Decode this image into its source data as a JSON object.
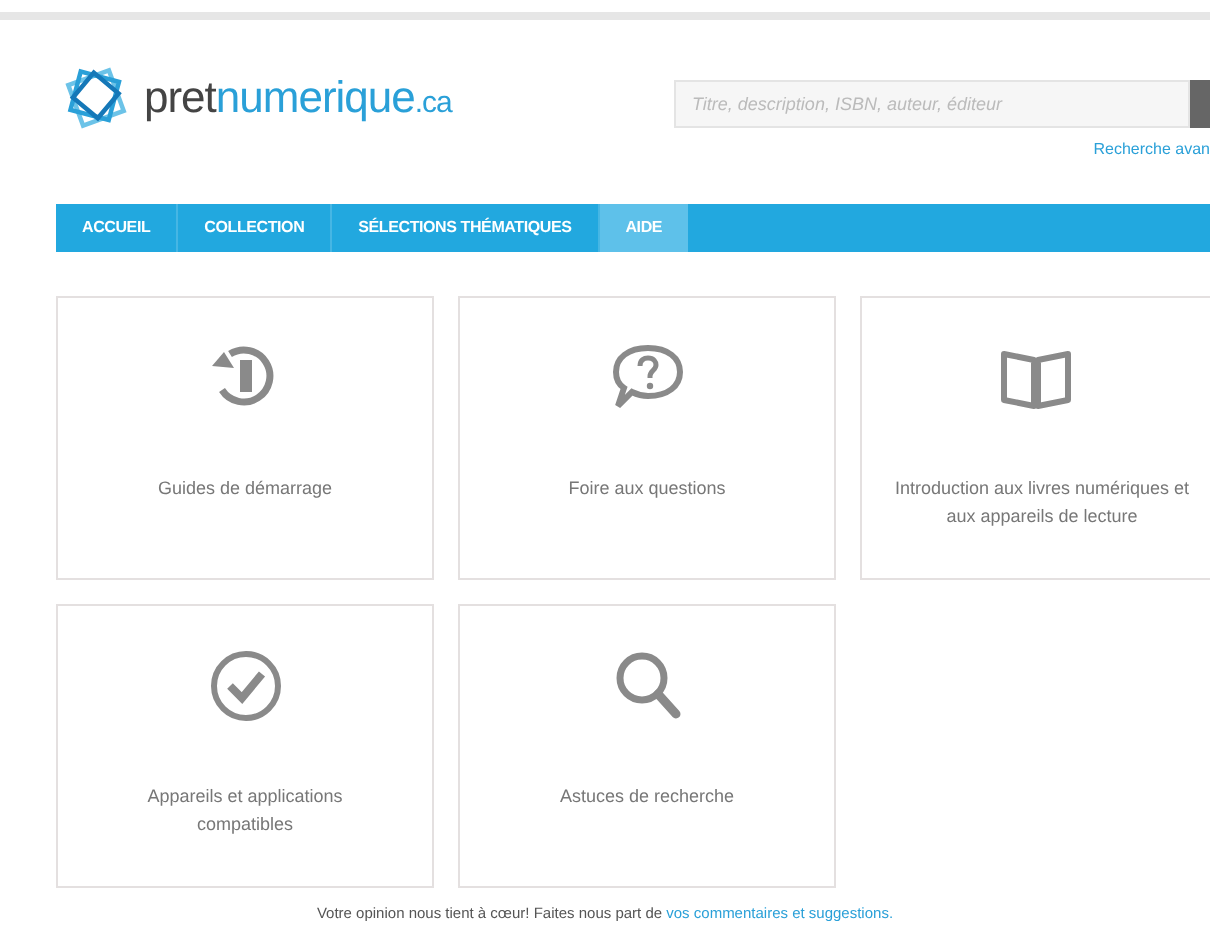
{
  "header": {
    "logo": {
      "name": "pret",
      "accent": "numerique",
      "suffix": ".ca"
    },
    "search": {
      "placeholder": "Titre, description, ISBN, auteur, éditeur"
    },
    "advanced_link": "Recherche avan"
  },
  "nav": [
    {
      "label": "ACCUEIL",
      "selected": false
    },
    {
      "label": "COLLECTION",
      "selected": false
    },
    {
      "label": "SÉLECTIONS THÉMATIQUES",
      "selected": false
    },
    {
      "label": "AIDE",
      "selected": true
    }
  ],
  "cards": [
    {
      "kind": "restart",
      "label": "Guides de démarrage"
    },
    {
      "kind": "question",
      "label": "Foire aux questions"
    },
    {
      "kind": "book",
      "label": "Introduction aux livres numériques et aux appareils de lecture"
    },
    {
      "kind": "check",
      "label": "Appareils et applications compatibles"
    },
    {
      "kind": "search",
      "label": "Astuces de recherche"
    }
  ],
  "footer": {
    "text": "Votre opinion nous tient à cœur! Faites nous part de",
    "link": "vos commentaires et suggestions."
  }
}
